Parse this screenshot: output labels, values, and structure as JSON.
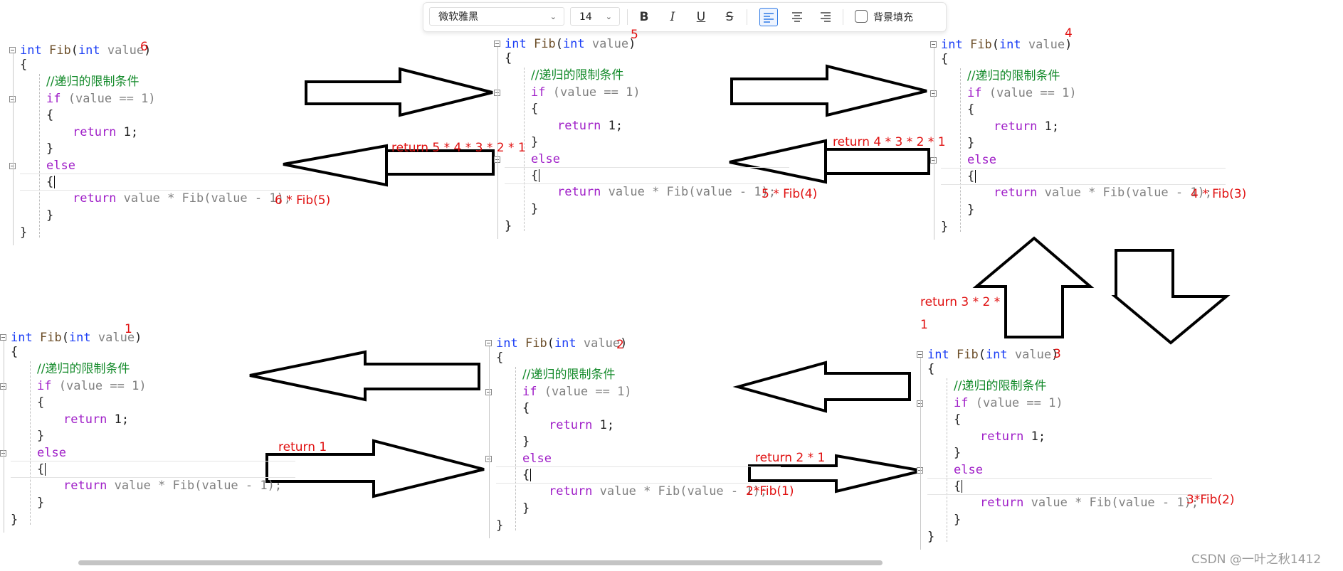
{
  "toolbar": {
    "font": "微软雅黑",
    "size": "14",
    "bold": "B",
    "italic": "I",
    "underline": "U",
    "strike": "S",
    "bg_fill": "背景填充"
  },
  "code": {
    "signature": "int Fib(int value)",
    "kw_int": "int",
    "fn_name": "Fib",
    "param": "value",
    "open_brace": "{",
    "close_brace": "}",
    "comment": "//递归的限制条件",
    "if_kw": "if",
    "if_cond": "(value == 1)",
    "return_kw": "return",
    "return_one": "1;",
    "else_kw": "else",
    "return_expr": "value * Fib(value - 1);"
  },
  "blocks": [
    {
      "id": "6",
      "number": "6",
      "annotation": "6 * Fib(5)"
    },
    {
      "id": "5",
      "number": "5",
      "annotation": "5 * Fib(4)"
    },
    {
      "id": "4",
      "number": "4",
      "annotation": "4 * Fib(3)"
    },
    {
      "id": "3",
      "number": "3",
      "annotation": "3*Fib(2)"
    },
    {
      "id": "2",
      "number": "2",
      "annotation": "2*Fib(1)"
    },
    {
      "id": "1",
      "number": "1",
      "annotation": ""
    }
  ],
  "returns": {
    "r5": "return 5 * 4 * 3 * 2 * 1",
    "r4": "return 4 * 3 * 2 * 1",
    "r3a": "return 3 * 2 *",
    "r3b": "1",
    "r2": "return 2 * 1",
    "r1": "return 1"
  },
  "watermark": "CSDN @一叶之秋1412"
}
